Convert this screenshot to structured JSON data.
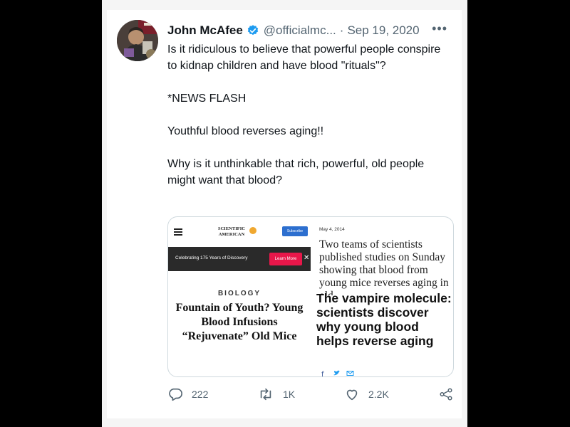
{
  "tweet": {
    "author_name": "John McAfee",
    "handle": "@officialmc...",
    "separator": "·",
    "date": "Sep 19, 2020",
    "more": "•••",
    "paragraphs": [
      "Is it ridiculous to believe that powerful people conspire to kidnap children and have blood \"rituals\"?",
      "*NEWS FLASH",
      "Youthful blood reverses aging!!",
      "Why is it unthinkable that rich, powerful, old people might want that blood?"
    ]
  },
  "media": {
    "left": {
      "logo_line1": "SCIENTIFIC",
      "logo_line2": "AMERICAN",
      "subscribe": "Subscribe",
      "promo": "Celebrating 175 Years of Discovery",
      "learn_more": "Learn More",
      "close": "✕",
      "topic": "BIOLOGY",
      "headline": "Fountain of Youth? Young Blood Infusions “Rejuvenate” Old Mice"
    },
    "right": {
      "date": "May 4, 2014",
      "excerpt": "Two teams of scientists published studies on Sunday showing that blood from young mice reverses aging in old",
      "title": "The vampire molecule: scientists discover why young blood helps reverse aging"
    }
  },
  "actions": {
    "replies": "222",
    "retweets": "1K",
    "likes": "2.2K"
  },
  "colors": {
    "verified": "#1d9bf0",
    "muted": "#536471",
    "promo_button": "#e8174a"
  }
}
